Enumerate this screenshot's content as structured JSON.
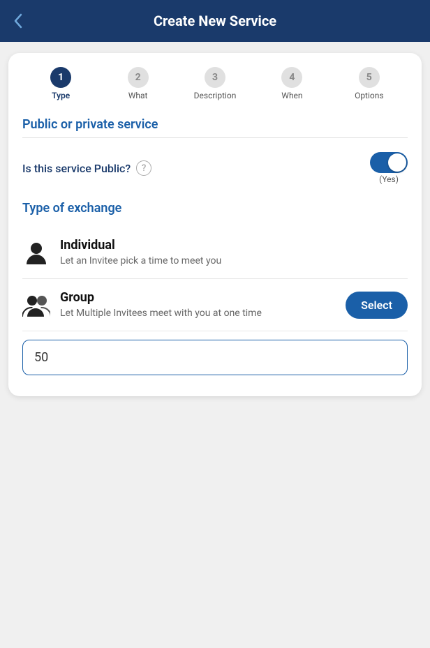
{
  "header": {
    "title": "Create New Service",
    "back_icon": "‹"
  },
  "steps": [
    {
      "number": "1",
      "label": "Type",
      "active": true
    },
    {
      "number": "2",
      "label": "What",
      "active": false
    },
    {
      "number": "3",
      "label": "Description",
      "active": false
    },
    {
      "number": "4",
      "label": "When",
      "active": false
    },
    {
      "number": "5",
      "label": "Options",
      "active": false
    }
  ],
  "public_section": {
    "title": "Public or private service",
    "toggle_label": "Is this service Public?",
    "toggle_state": "on",
    "toggle_value_label": "(Yes)"
  },
  "exchange_section": {
    "title": "Type of exchange",
    "options": [
      {
        "name": "Individual",
        "description": "Let an Invitee pick a time to meet you",
        "icon_type": "person",
        "has_select": false
      },
      {
        "name": "Group",
        "description": "Let Multiple Invitees meet with you at one time",
        "icon_type": "group",
        "has_select": true,
        "select_label": "Select"
      }
    ],
    "input_value": "50"
  }
}
